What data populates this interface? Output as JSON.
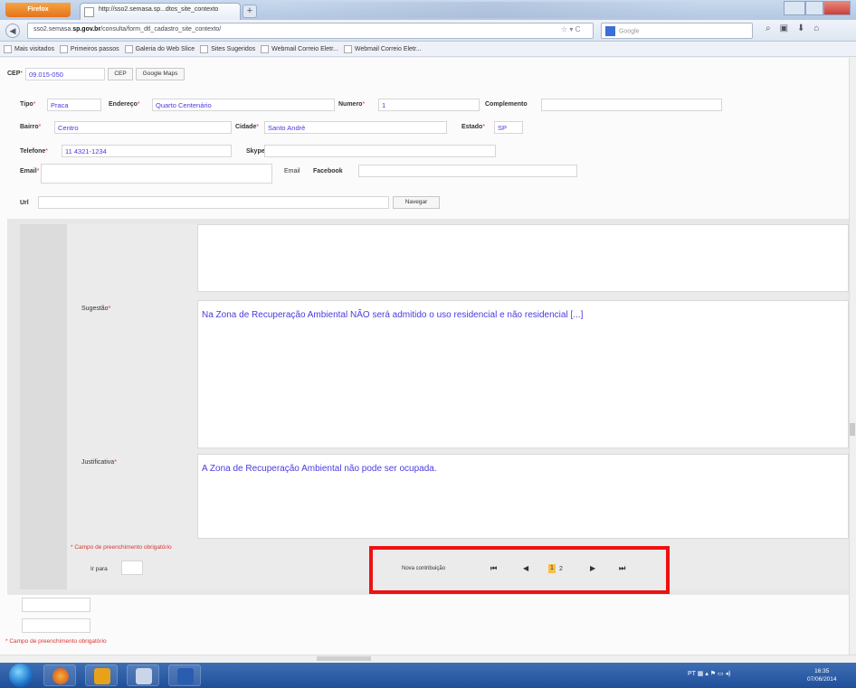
{
  "browser": {
    "firefox_label": "Firefox",
    "tab_title": "http://sso2.semasa.sp...dtos_site_contexto",
    "new_tab": "+",
    "url_prefix": "sso2.semasa.",
    "url_domain": "sp.gov.br",
    "url_rest": "/consulta/form_dtl_cadastro_site_contexto/",
    "search_placeholder": "Google",
    "bookmarks": [
      "Mais visitados",
      "Primeiros passos",
      "Galeria do Web Slice",
      "Sites Sugeridos",
      "Webmail Correio Eletr...",
      "Webmail Correio Eletr..."
    ]
  },
  "form": {
    "cep_label": "CEP",
    "cep_value": "09.015-050",
    "cep_button": "CEP",
    "maps_button": "Google Maps",
    "tipo_label": "Tipo",
    "tipo_value": "Praca",
    "endereco_label": "Endereço",
    "endereco_value": "Quarto Centenário",
    "numero_label": "Numero",
    "numero_value": "1",
    "complemento_label": "Complemento",
    "bairro_label": "Bairro",
    "bairro_value": "Centro",
    "cidade_label": "Cidade",
    "cidade_value": "Santo André",
    "estado_label": "Estado",
    "estado_value": "SP",
    "telefone_label": "Telefone",
    "telefone_value": "11 4321-1234",
    "skype_label": "Skype",
    "email_label": "Email",
    "email2_label": "Email",
    "facebook_label": "Facebook",
    "url_label": "Url",
    "navegar_button": "Navegar",
    "required_mark": "*"
  },
  "contribution": {
    "sugestao_label": "Sugestão",
    "sugestao_text": "Na Zona de Recuperação Ambiental NÃO será admitido o uso residencial e não residencial [...]",
    "justificativa_label": "Justificativa",
    "justificativa_text": "A Zona de Recuperação Ambiental não pode ser ocupada.",
    "required_note": "* Campo de preenchimento obrigatório",
    "goto_label": "Ir para",
    "new_contribution": "Nova contribuição",
    "page_current": "1",
    "page_total": "2"
  },
  "footer_note": "* Campo de preenchimento obrigatório",
  "tray": {
    "lang": "PT",
    "time": "16:35",
    "date": "07/06/2014"
  }
}
